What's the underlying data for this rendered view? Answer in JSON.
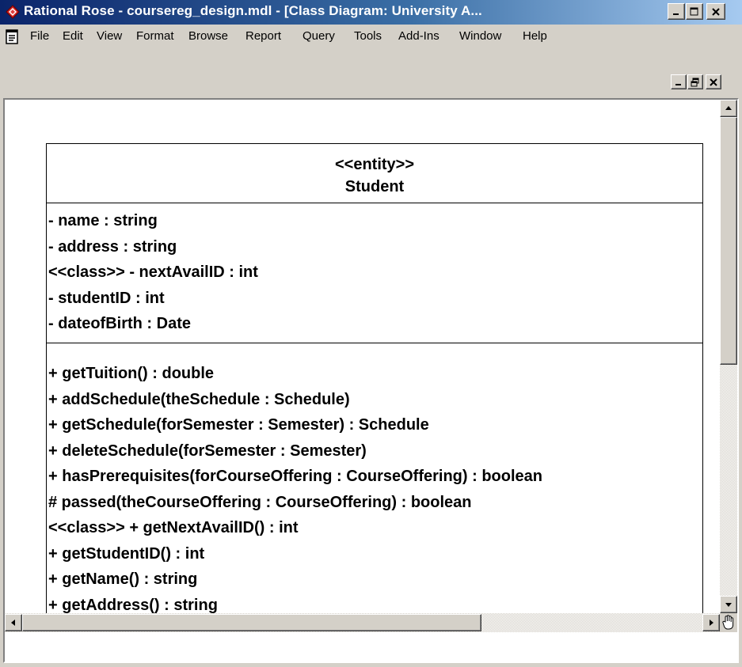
{
  "window": {
    "title": "Rational Rose - coursereg_design.mdl - [Class Diagram: University A...",
    "controls": [
      "minimize",
      "maximize",
      "close"
    ]
  },
  "menu": {
    "items": [
      {
        "label": "File"
      },
      {
        "label": "Edit"
      },
      {
        "label": "View"
      },
      {
        "label": "Format"
      },
      {
        "label": "Browse"
      },
      {
        "label": "Report"
      },
      {
        "label": "Query"
      },
      {
        "label": "Tools"
      },
      {
        "label": "Add-Ins"
      },
      {
        "label": "Window"
      },
      {
        "label": "Help"
      }
    ]
  },
  "diagram": {
    "class": {
      "stereotype": "<<entity>>",
      "name": "Student",
      "attributes": [
        "- name : string",
        "- address : string",
        "<<class>> - nextAvailID : int",
        "- studentID : int",
        "- dateofBirth : Date"
      ],
      "operations": [
        "+ getTuition() : double",
        "+ addSchedule(theSchedule : Schedule)",
        "+ getSchedule(forSemester : Semester) : Schedule",
        "+ deleteSchedule(forSemester : Semester)",
        "+ hasPrerequisites(forCourseOffering : CourseOffering) : boolean",
        "# passed(theCourseOffering : CourseOffering) : boolean",
        "<<class>> + getNextAvailID() : int",
        "+ getStudentID() : int",
        "+ getName() : string",
        "+ getAddress() : string"
      ]
    }
  },
  "icons": {
    "app": "rational-rose-icon",
    "document": "document-icon",
    "pan": "hand-pan-icon"
  },
  "colors": {
    "title_bar_start": "#0a246a",
    "title_bar_end": "#a6caf0",
    "chrome": "#d4d0c8",
    "canvas": "#ffffff"
  }
}
